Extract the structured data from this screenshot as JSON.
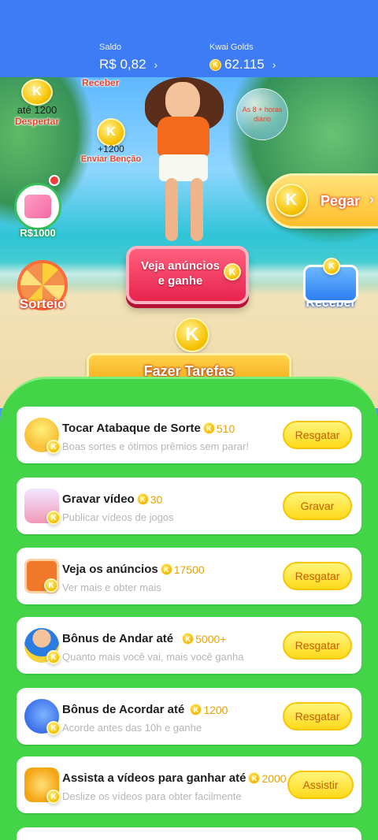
{
  "header": {
    "saldo_label": "Saldo",
    "saldo_value": "R$ 0,82",
    "saldo_chevron": "›",
    "golds_label": "Kwai Golds",
    "golds_value": "62.115",
    "golds_chevron": "›",
    "coin_letter": "K"
  },
  "scene": {
    "receber_top": "Receber",
    "despertar_amount": "até 1200",
    "despertar_label": "Despertar",
    "bencao_amount": "+1200",
    "bencao_label": "Enviar Benção",
    "bubble_text": "As 8 + horas diário",
    "gift_label": "R$1000",
    "pegar_label": "Pegar",
    "pegar_arrow": "›",
    "sorteio_label": "Sorteio",
    "receber_label": "Receber",
    "ads_button_label": "Veja anúncios e ganhe",
    "tasks_banner": "Fazer Tarefas"
  },
  "tasks": [
    {
      "title": "Tocar Atabaque de Sorte",
      "reward": "510",
      "subtitle": "Boas sortes e ótimos prêmios sem parar!",
      "button": "Resgatar",
      "icon": "atabaque-icon"
    },
    {
      "title": "Gravar vídeo",
      "reward": "30",
      "subtitle": "Publicar vídeos de jogos",
      "button": "Gravar",
      "icon": "video-camera-icon"
    },
    {
      "title": "Veja os anúncios",
      "reward": "17500",
      "subtitle": "Ver mais e obter mais",
      "button": "Resgatar",
      "icon": "tv-icon"
    },
    {
      "title": "Bônus de Andar até",
      "reward": "5000+",
      "subtitle": "Quanto mais você vai, mais você ganha",
      "button": "Resgatar",
      "icon": "walking-boy-icon"
    },
    {
      "title": "Bônus de Acordar até",
      "reward": "1200",
      "subtitle": "Acorde antes das 10h e ganhe",
      "button": "Resgatar",
      "icon": "moon-icon"
    },
    {
      "title": "Assista a vídeos para ganhar até",
      "reward": "2000",
      "subtitle": "Deslize os vídeos para obter facilmente",
      "button": "Assistir",
      "icon": "movie-camera-icon"
    }
  ],
  "colors": {
    "topbar": "#3d7cf4",
    "panel_green": "#43d448",
    "button_yellow": "#ffd91a",
    "reward_gold": "#e8a400"
  }
}
